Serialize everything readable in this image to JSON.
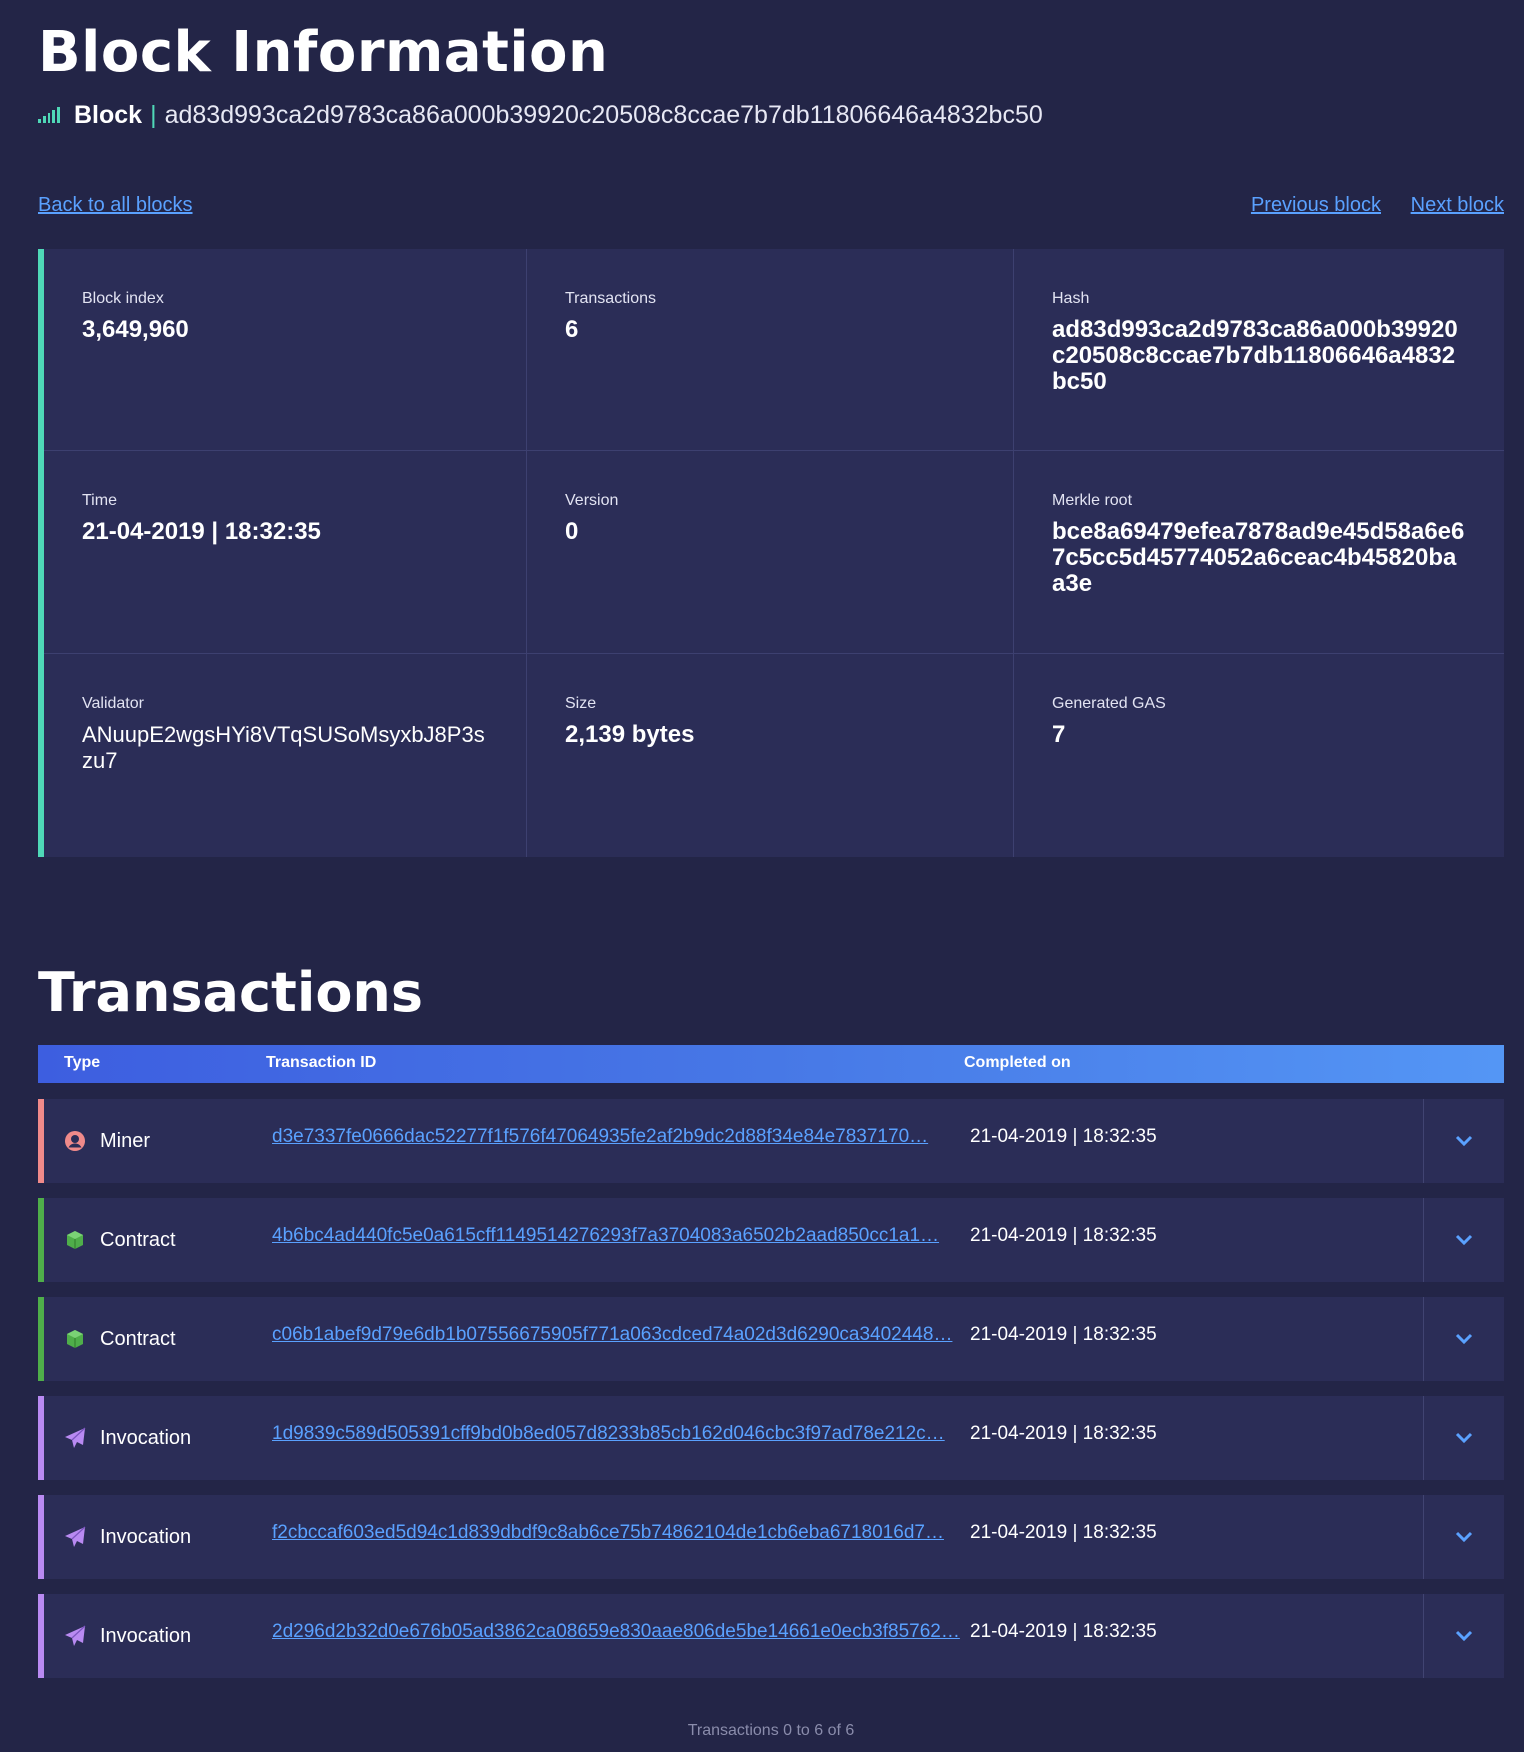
{
  "page": {
    "title": "Block Information"
  },
  "block_line": {
    "label": "Block",
    "hash": "ad83d993ca2d9783ca86a000b39920c20508c8ccae7b7db11806646a4832bc50"
  },
  "nav": {
    "back": "Back to all blocks",
    "previous": "Previous block",
    "next": "Next block"
  },
  "info": [
    {
      "label": "Block index",
      "value": "3,649,960"
    },
    {
      "label": "Transactions",
      "value": "6"
    },
    {
      "label": "Hash",
      "value": "ad83d993ca2d9783ca86a000b39920c20508c8ccae7b7db11806646a4832bc50"
    },
    {
      "label": "Time",
      "value": "21-04-2019 | 18:32:35"
    },
    {
      "label": "Version",
      "value": "0"
    },
    {
      "label": "Merkle root",
      "value": "bce8a69479efea7878ad9e45d58a6e67c5cc5d45774052a6ceac4b45820baa3e"
    },
    {
      "label": "Validator",
      "value": "ANuupE2wgsHYi8VTqSUSoMsyxbJ8P3szu7"
    },
    {
      "label": "Size",
      "value": "2,139 bytes"
    },
    {
      "label": "Generated GAS",
      "value": "7"
    }
  ],
  "transactions": {
    "title": "Transactions",
    "columns": {
      "type": "Type",
      "id": "Transaction ID",
      "completed": "Completed on"
    },
    "rows": [
      {
        "type": "Miner",
        "icon": "user-circle-icon",
        "color": "#f08a8a",
        "id": "d3e7337fe0666dac52277f1f576f47064935fe2af2b9dc2d88f34e84e7837170…",
        "completed": "21-04-2019 | 18:32:35"
      },
      {
        "type": "Contract",
        "icon": "cube-icon",
        "color": "#4fae4a",
        "id": "4b6bc4ad440fc5e0a615cff1149514276293f7a3704083a6502b2aad850cc1a1…",
        "completed": "21-04-2019 | 18:32:35"
      },
      {
        "type": "Contract",
        "icon": "cube-icon",
        "color": "#4fae4a",
        "id": "c06b1abef9d79e6db1b07556675905f771a063cdced74a02d3d6290ca3402448…",
        "completed": "21-04-2019 | 18:32:35"
      },
      {
        "type": "Invocation",
        "icon": "paper-plane-icon",
        "color": "#b98af2",
        "id": "1d9839c589d505391cff9bd0b8ed057d8233b85cb162d046cbc3f97ad78e212c…",
        "completed": "21-04-2019 | 18:32:35"
      },
      {
        "type": "Invocation",
        "icon": "paper-plane-icon",
        "color": "#b98af2",
        "id": "f2cbccaf603ed5d94c1d839dbdf9c8ab6ce75b74862104de1cb6eba6718016d7…",
        "completed": "21-04-2019 | 18:32:35"
      },
      {
        "type": "Invocation",
        "icon": "paper-plane-icon",
        "color": "#b98af2",
        "id": "2d296d2b32d0e676b05ad3862ca08659e830aae806de5be14661e0ecb3f85762…",
        "completed": "21-04-2019 | 18:32:35"
      }
    ],
    "footer": "Transactions 0 to 6 of 6"
  },
  "colors": {
    "background": "#232547",
    "card": "#2b2d57",
    "accent": "#4fd8b7",
    "link": "#5aa1ff"
  }
}
